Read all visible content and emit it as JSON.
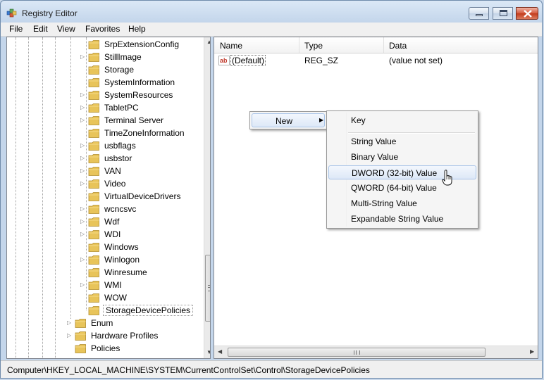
{
  "window": {
    "title": "Registry Editor"
  },
  "menu": [
    "File",
    "Edit",
    "View",
    "Favorites",
    "Help"
  ],
  "tree": {
    "items": [
      {
        "label": "SrpExtensionConfig",
        "expandable": false
      },
      {
        "label": "StillImage",
        "expandable": true
      },
      {
        "label": "Storage",
        "expandable": false
      },
      {
        "label": "SystemInformation",
        "expandable": false
      },
      {
        "label": "SystemResources",
        "expandable": true
      },
      {
        "label": "TabletPC",
        "expandable": true
      },
      {
        "label": "Terminal Server",
        "expandable": true
      },
      {
        "label": "TimeZoneInformation",
        "expandable": false
      },
      {
        "label": "usbflags",
        "expandable": true
      },
      {
        "label": "usbstor",
        "expandable": true
      },
      {
        "label": "VAN",
        "expandable": true
      },
      {
        "label": "Video",
        "expandable": true
      },
      {
        "label": "VirtualDeviceDrivers",
        "expandable": false
      },
      {
        "label": "wcncsvc",
        "expandable": true
      },
      {
        "label": "Wdf",
        "expandable": true
      },
      {
        "label": "WDI",
        "expandable": true
      },
      {
        "label": "Windows",
        "expandable": false
      },
      {
        "label": "Winlogon",
        "expandable": true
      },
      {
        "label": "Winresume",
        "expandable": false
      },
      {
        "label": "WMI",
        "expandable": true
      },
      {
        "label": "WOW",
        "expandable": false
      },
      {
        "label": "StorageDevicePolicies",
        "expandable": false,
        "selected": true
      }
    ],
    "parent_items": [
      {
        "label": "Enum",
        "expandable": true
      },
      {
        "label": "Hardware Profiles",
        "expandable": true
      },
      {
        "label": "Policies",
        "expandable": false
      }
    ]
  },
  "list": {
    "columns": [
      "Name",
      "Type",
      "Data"
    ],
    "rows": [
      {
        "icon": "string-value-icon",
        "name": "(Default)",
        "type": "REG_SZ",
        "data": "(value not set)"
      }
    ]
  },
  "context_menu": {
    "new_label": "New",
    "submenu": [
      "Key",
      "String Value",
      "Binary Value",
      "DWORD (32-bit) Value",
      "QWORD (64-bit) Value",
      "Multi-String Value",
      "Expandable String Value"
    ],
    "highlighted": "DWORD (32-bit) Value"
  },
  "status": {
    "path": "Computer\\HKEY_LOCAL_MACHINE\\SYSTEM\\CurrentControlSet\\Control\\StorageDevicePolicies"
  },
  "colors": {
    "folder": "#e8c45a",
    "highlight_border": "#a8c4e8",
    "title_bar": "#c4d6eb"
  }
}
